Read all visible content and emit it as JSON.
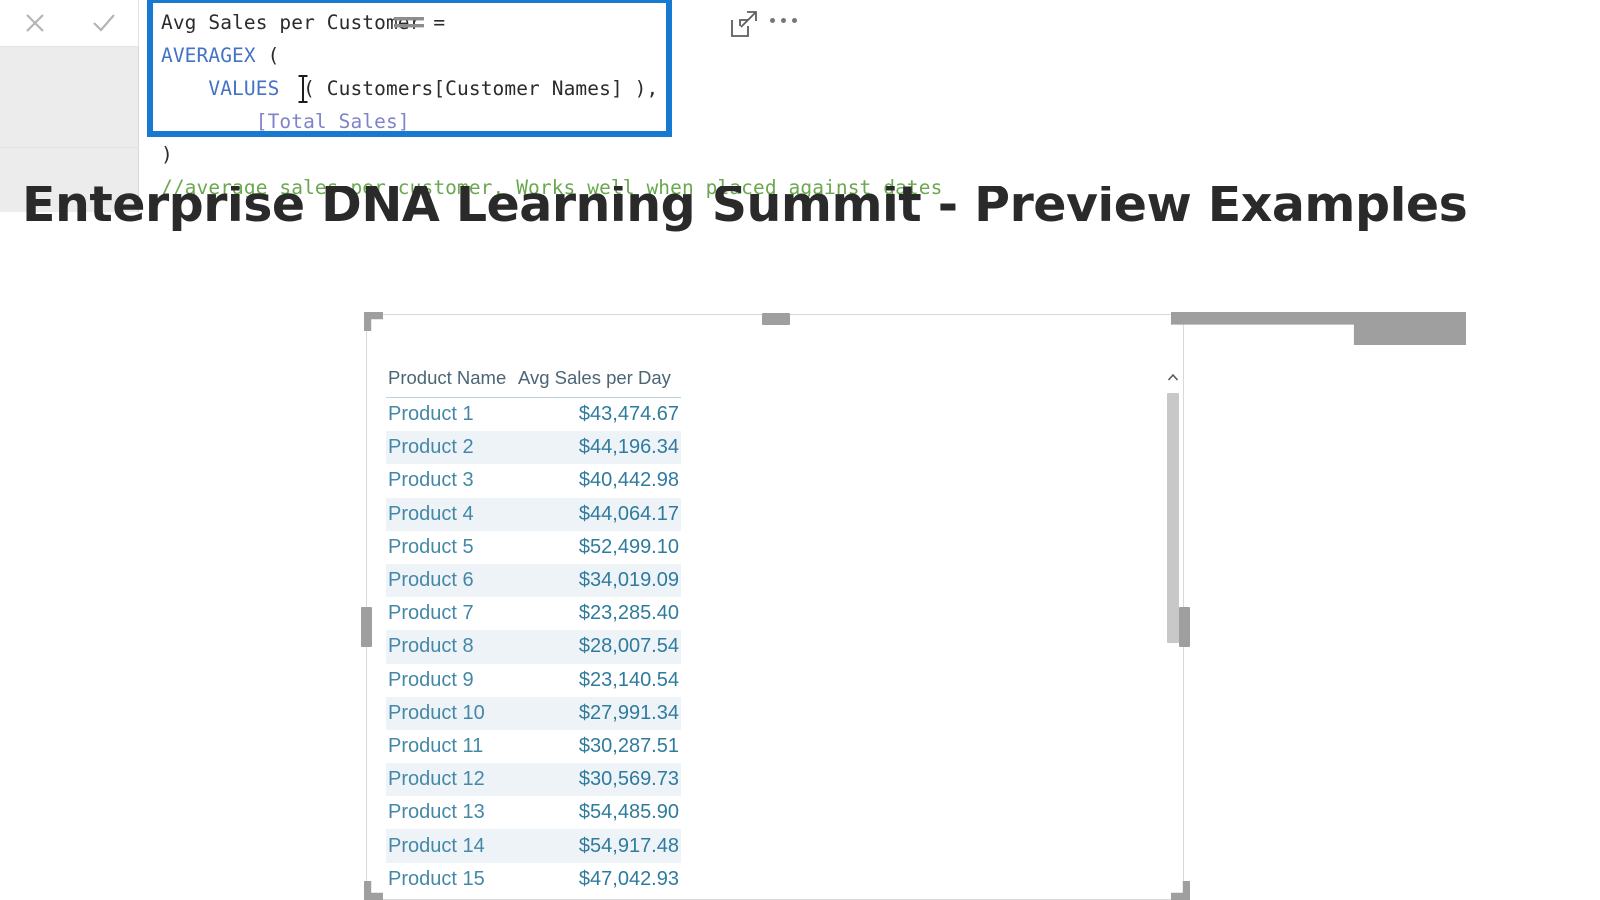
{
  "formula_editor": {
    "cancel_label": "Cancel",
    "commit_label": "Commit",
    "cancel_icon": "close-icon",
    "commit_icon": "checkmark-icon",
    "caret_icon": "text-cursor-ibeam",
    "lines": {
      "line1": "Avg Sales per Customer =",
      "line2_fn": "AVERAGEX",
      "line2_rest": " (",
      "line3_indent": "    ",
      "line3_fn": "VALUES",
      "line3_rest": "  ( Customers[Customer Names] ),",
      "line4_indent": "        ",
      "line4_measure": "[Total Sales]",
      "line5": ")",
      "line6_comment": "//average sales per customer. Works well when placed against dates"
    },
    "highlight_color": "#1879d1",
    "function_color": "#4472c4",
    "measure_color": "#7f84c8",
    "comment_color": "#6aa84f"
  },
  "report": {
    "title": "Enterprise DNA Learning Summit - Preview Examples"
  },
  "visual": {
    "drag_handle_icon": "drag-handle-icon",
    "focus_mode_icon": "focus-mode-icon",
    "more_options_icon": "more-options-icon",
    "scroll_up_icon": "chevron-up-icon",
    "columns": [
      "Product Name",
      "Avg Sales per Day"
    ],
    "rows": [
      {
        "product": "Product 1",
        "value": "$43,474.67"
      },
      {
        "product": "Product 2",
        "value": "$44,196.34"
      },
      {
        "product": "Product 3",
        "value": "$40,442.98"
      },
      {
        "product": "Product 4",
        "value": "$44,064.17"
      },
      {
        "product": "Product 5",
        "value": "$52,499.10"
      },
      {
        "product": "Product 6",
        "value": "$34,019.09"
      },
      {
        "product": "Product 7",
        "value": "$23,285.40"
      },
      {
        "product": "Product 8",
        "value": "$28,007.54"
      },
      {
        "product": "Product 9",
        "value": "$23,140.54"
      },
      {
        "product": "Product 10",
        "value": "$27,991.34"
      },
      {
        "product": "Product 11",
        "value": "$30,287.51"
      },
      {
        "product": "Product 12",
        "value": "$30,569.73"
      },
      {
        "product": "Product 13",
        "value": "$54,485.90"
      },
      {
        "product": "Product 14",
        "value": "$54,917.48"
      },
      {
        "product": "Product 15",
        "value": "$47,042.93"
      }
    ]
  }
}
